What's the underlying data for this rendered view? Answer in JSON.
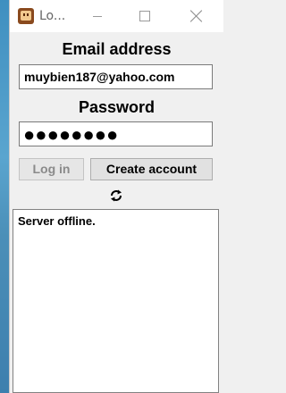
{
  "window": {
    "title": "Lo...",
    "controls": {
      "minimize": "minimize",
      "maximize": "maximize",
      "close": "close"
    }
  },
  "form": {
    "email_label": "Email address",
    "email_value": "muybien187@yahoo.com",
    "password_label": "Password",
    "password_masked": "●●●●●●●●",
    "login_button": "Log in",
    "create_account_button": "Create account"
  },
  "status": {
    "message": "Server offline."
  },
  "icons": {
    "app": "app-icon",
    "refresh": "refresh-icon"
  },
  "colors": {
    "window_bg": "#f0f0f0",
    "titlebar_bg": "#ffffff",
    "disabled_text": "#8a8a8a"
  }
}
